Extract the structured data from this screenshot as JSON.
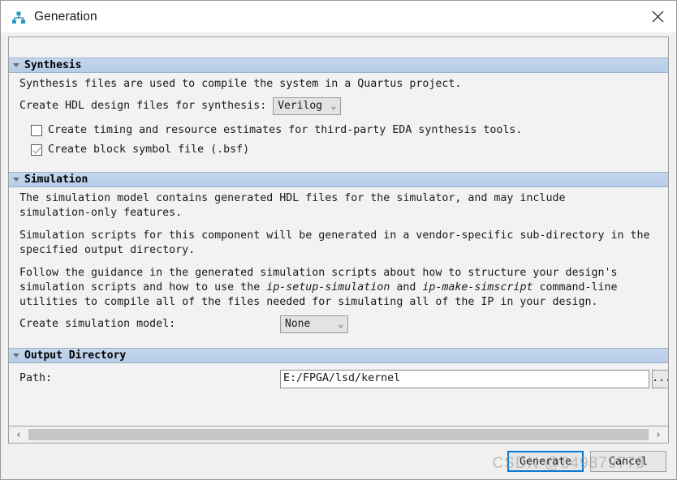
{
  "window": {
    "title": "Generation",
    "icon": "hierarchy-icon",
    "close_icon": "close-icon",
    "accent_color": "#0a7ad1",
    "header_color": "#bdd1ea"
  },
  "sections": {
    "synthesis": {
      "title": "Synthesis",
      "intro": "Synthesis files are used to compile the system in a Quartus project.",
      "hdl_label": "Create HDL design files for synthesis:",
      "hdl_value": "Verilog",
      "checkbox_timing": {
        "label": "Create timing and resource estimates for third-party EDA synthesis tools.",
        "checked": false
      },
      "checkbox_bsf": {
        "label": "Create block symbol file (.bsf)",
        "checked": true
      }
    },
    "simulation": {
      "title": "Simulation",
      "para1_line1": "The simulation model contains generated HDL files for the simulator, and may include",
      "para1_line2": "simulation-only features.",
      "para2_line1": "Simulation scripts for this component will be generated in a vendor-specific sub-directory in the",
      "para2_line2": "specified output directory.",
      "para3_line1": "Follow the guidance in the generated simulation scripts about how to structure your design's",
      "para3_line2_a": "simulation scripts and how to use the ",
      "para3_line2_italic1": "ip-setup-simulation",
      "para3_line2_b": " and ",
      "para3_line2_italic2": "ip-make-simscript",
      "para3_line2_c": " command-line",
      "para3_line3": "utilities to compile all of the files needed for simulating all of the IP in your design.",
      "model_label": "Create simulation model:",
      "model_value": "None"
    },
    "output_directory": {
      "title": "Output Directory",
      "path_label": "Path:",
      "path_value": "E:/FPGA/lsd/kernel",
      "browse_label": "..."
    }
  },
  "scrollbar": {
    "left_arrow": "‹",
    "right_arrow": "›"
  },
  "footer": {
    "generate_label": "Generate",
    "cancel_label": "Cancel",
    "watermark": "CSDN @849879773"
  },
  "combo": {
    "chevron": "⌄"
  }
}
